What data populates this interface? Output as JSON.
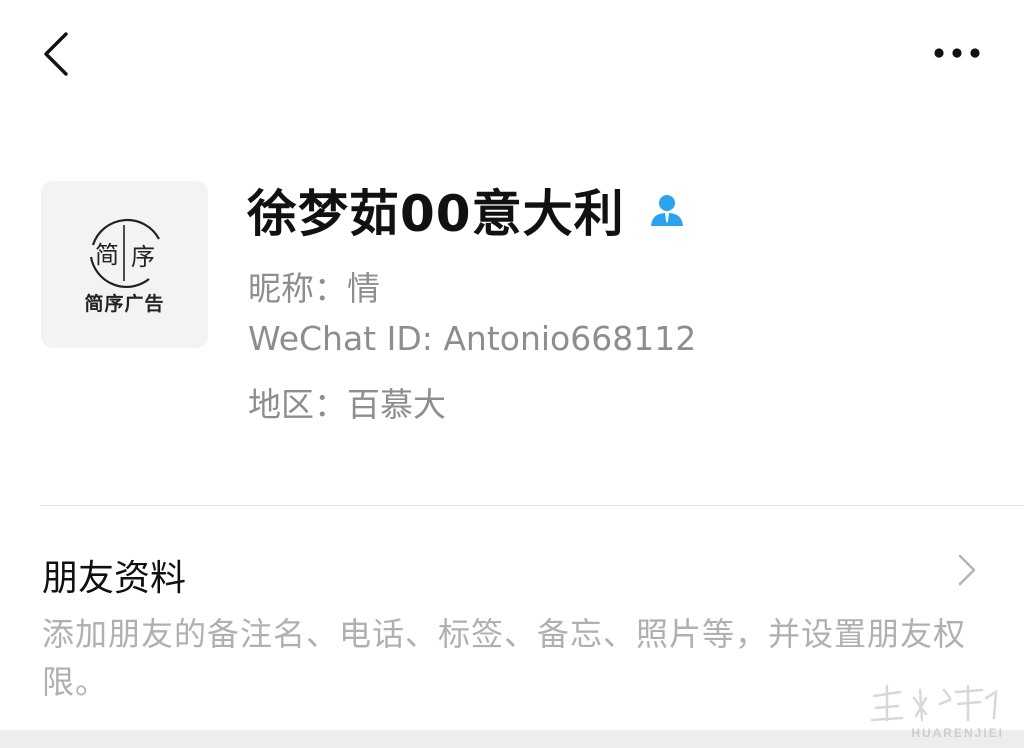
{
  "nav": {
    "back_icon": "chevron-left-icon",
    "more_icon": "more-horizontal-icon"
  },
  "profile": {
    "avatar_caption": "简序广告",
    "avatar_logo_text": "简序",
    "display_name": "徐梦茹00意大利",
    "gender_icon": "person-badge-icon",
    "nickname_label": "昵称：",
    "nickname_value": "情",
    "wechat_id_label": "WeChat ID: ",
    "wechat_id_value": "Antonio668112",
    "region_label": "地区：",
    "region_value": "百慕大"
  },
  "friend_info": {
    "title": "朋友资料",
    "description": "添加朋友的备注名、电话、标签、备忘、照片等，并设置朋友权限。"
  },
  "watermark": {
    "text": "HUARENJIEI"
  },
  "colors": {
    "accent_blue": "#2aa2ee",
    "text_primary": "#111111",
    "text_secondary": "#8e8e8e",
    "text_tertiary": "#b0b0b0"
  }
}
